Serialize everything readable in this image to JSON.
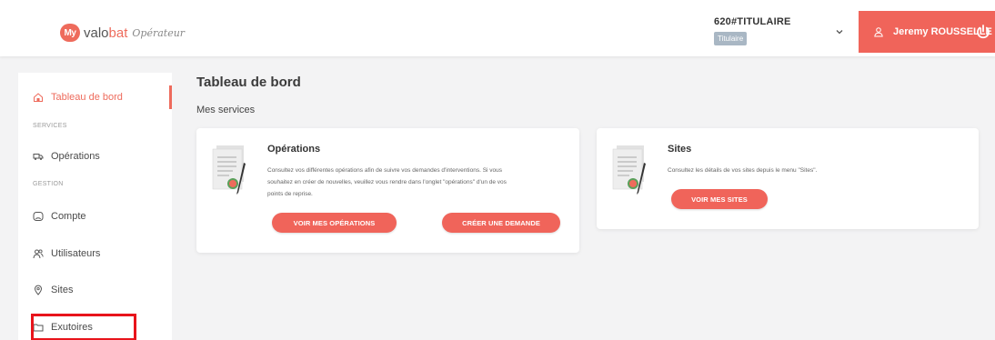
{
  "brand": {
    "badge": "My",
    "name_prefix": "valo",
    "name_accent": "bat",
    "subtitle": "Opérateur"
  },
  "header": {
    "org_code": "620#TITULAIRE",
    "org_role": "Titulaire",
    "user_name": "Jeremy ROUSSELLE"
  },
  "sidebar": {
    "items": [
      {
        "label": "Tableau de bord",
        "icon": "home-icon",
        "active": true
      },
      {
        "label": "Opérations",
        "icon": "truck-icon"
      },
      {
        "label": "Compte",
        "icon": "account-icon"
      },
      {
        "label": "Utilisateurs",
        "icon": "users-icon"
      },
      {
        "label": "Sites",
        "icon": "location-pin-icon"
      },
      {
        "label": "Exutoires",
        "icon": "folder-icon"
      }
    ],
    "sections": [
      "SERVICES",
      "GESTION"
    ]
  },
  "main": {
    "title": "Tableau de bord",
    "section_title": "Mes services",
    "cards": [
      {
        "title": "Opérations",
        "description_lines": [
          "Consultez vos différentes opérations afin de suivre vos demandes d'interventions. Si vous",
          "souhaitez en créer de nouvelles, veuillez vous rendre dans l'onglet \"opérations\" d'un de vos",
          "points de reprise."
        ],
        "buttons": [
          "VOIR MES OPÉRATIONS",
          "CRÉER UNE DEMANDE"
        ]
      },
      {
        "title": "Sites",
        "description_lines": [
          "Consultez les détails de vos sites depuis le menu \"Sites\"."
        ],
        "buttons": [
          "VOIR MES SITES"
        ]
      }
    ]
  },
  "colors": {
    "accent": "#f0645a",
    "highlight": "#e8141b",
    "badge": "#a9b7c4"
  }
}
